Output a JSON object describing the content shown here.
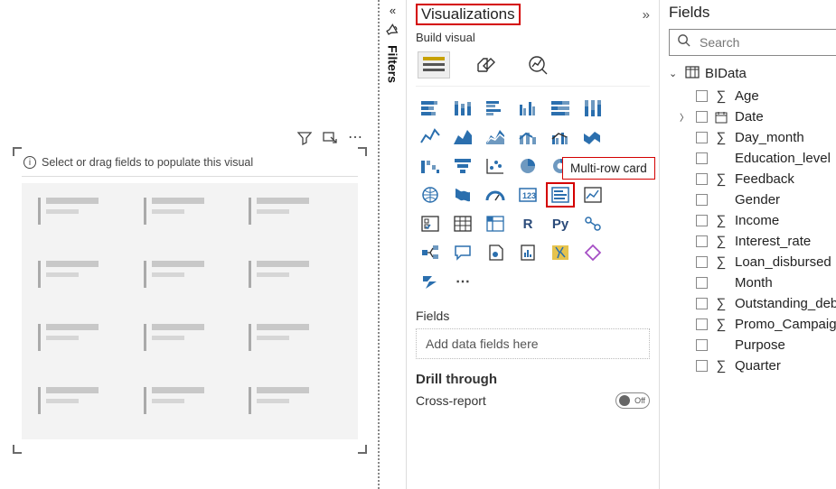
{
  "filters": {
    "label": "Filters"
  },
  "canvas": {
    "hint": "Select or drag fields to populate this visual"
  },
  "viz": {
    "title": "Visualizations",
    "subhead": "Build visual",
    "tooltip": "Multi-row card",
    "fields_section": "Fields",
    "fields_drop": "Add data fields here",
    "drill_label": "Drill through",
    "cross_report": "Cross-report",
    "toggle_off": "Off"
  },
  "fieldsPane": {
    "title": "Fields",
    "search_placeholder": "Search",
    "table": "BIData",
    "items": [
      {
        "name": "Age",
        "sigma": true
      },
      {
        "name": "Date",
        "date": true,
        "expandable": true
      },
      {
        "name": "Day_month",
        "sigma": true
      },
      {
        "name": "Education_level"
      },
      {
        "name": "Feedback",
        "sigma": true
      },
      {
        "name": "Gender"
      },
      {
        "name": "Income",
        "sigma": true
      },
      {
        "name": "Interest_rate",
        "sigma": true
      },
      {
        "name": "Loan_disbursed",
        "sigma": true
      },
      {
        "name": "Month"
      },
      {
        "name": "Outstanding_debt",
        "sigma": true
      },
      {
        "name": "Promo_Campaign",
        "sigma": true
      },
      {
        "name": "Purpose"
      },
      {
        "name": "Quarter",
        "sigma": true
      }
    ]
  }
}
